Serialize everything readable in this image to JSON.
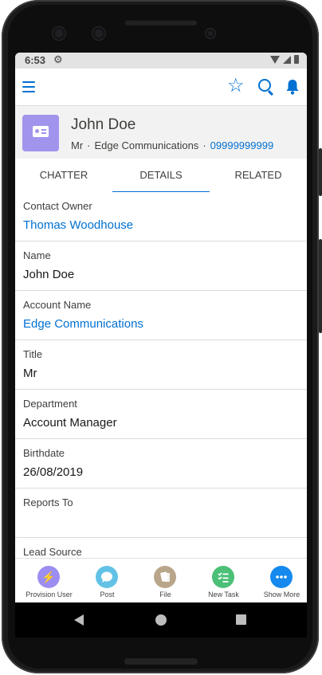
{
  "status_bar": {
    "time": "6:53"
  },
  "record": {
    "name": "John Doe",
    "salutation": "Mr",
    "separator": "·",
    "account": "Edge Communications",
    "phone": "09999999999"
  },
  "tabs": [
    {
      "label": "CHATTER",
      "active": false
    },
    {
      "label": "DETAILS",
      "active": true
    },
    {
      "label": "RELATED",
      "active": false
    }
  ],
  "fields": [
    {
      "label": "Contact Owner",
      "value": "Thomas Woodhouse",
      "link": true
    },
    {
      "label": "Name",
      "value": "John Doe",
      "link": false
    },
    {
      "label": "Account Name",
      "value": "Edge Communications",
      "link": true
    },
    {
      "label": "Title",
      "value": "Mr",
      "link": false
    },
    {
      "label": "Department",
      "value": "Account Manager",
      "link": false
    },
    {
      "label": "Birthdate",
      "value": "26/08/2019",
      "link": false
    },
    {
      "label": "Reports To",
      "value": "",
      "link": false
    },
    {
      "label": "Lead Source",
      "value": "",
      "link": false
    }
  ],
  "actions": [
    {
      "label": "Provision User",
      "color": "#9b8ef0",
      "icon": "lightning-icon"
    },
    {
      "label": "Post",
      "color": "#62c2e6",
      "icon": "chat-bubble-icon"
    },
    {
      "label": "File",
      "color": "#b9a58a",
      "icon": "file-icon"
    },
    {
      "label": "New Task",
      "color": "#4bc076",
      "icon": "task-checklist-icon"
    },
    {
      "label": "Show More",
      "color": "#1589ee",
      "icon": "more-icon"
    }
  ],
  "colors": {
    "accent": "#0070d2",
    "avatar": "#a094ed",
    "header_bg": "#f3f2f2"
  }
}
